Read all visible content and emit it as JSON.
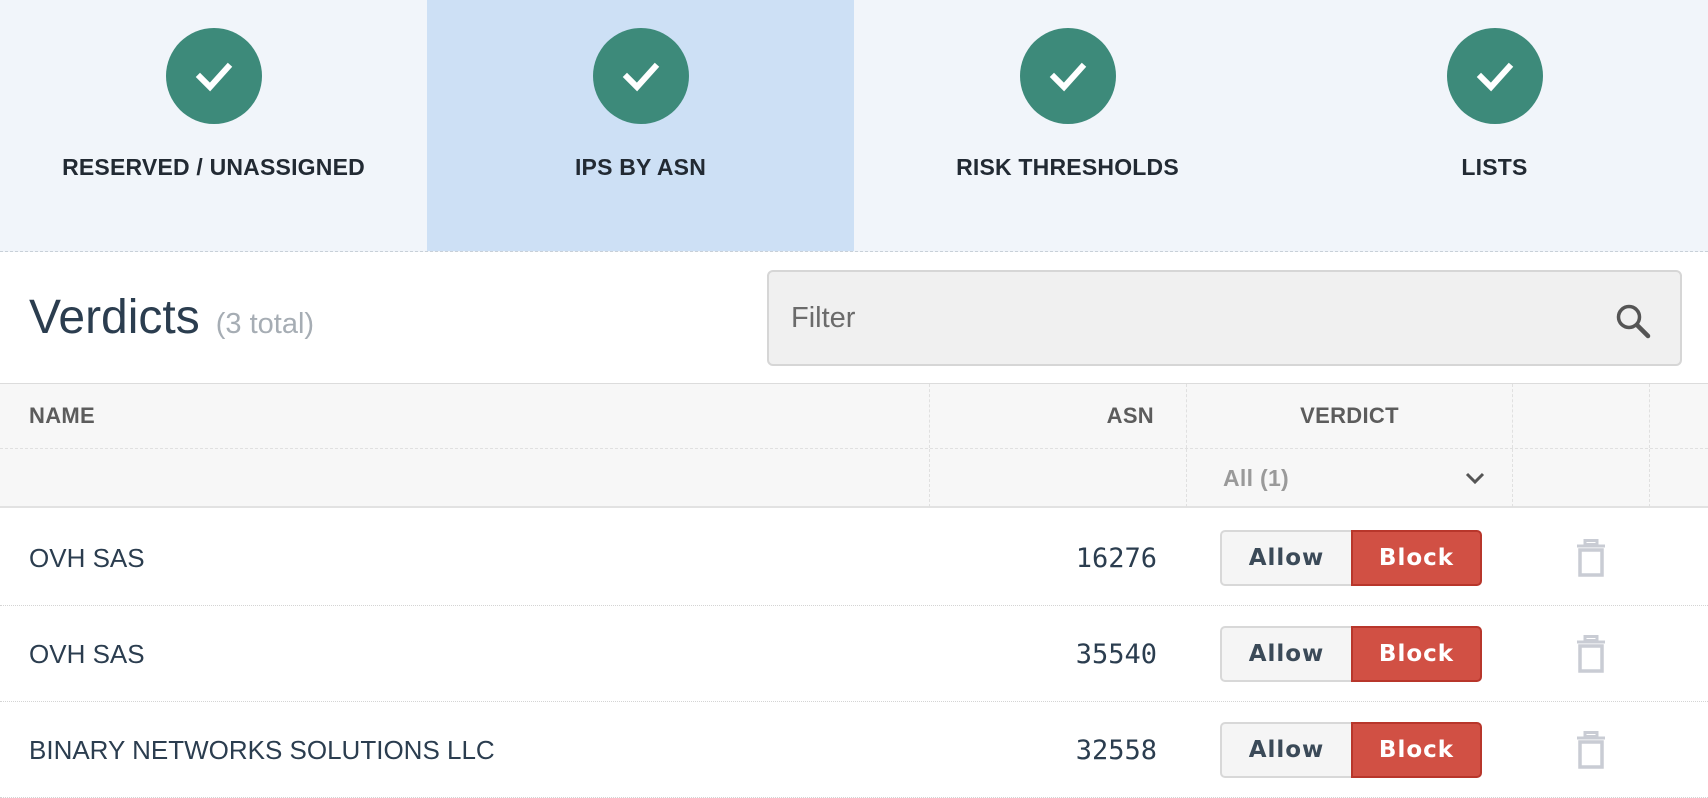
{
  "steps": [
    {
      "label": "RESERVED / UNASSIGNED",
      "status": "complete",
      "active": false
    },
    {
      "label": "IPS BY ASN",
      "status": "complete",
      "active": true
    },
    {
      "label": "RISK THRESHOLDS",
      "status": "complete",
      "active": false
    },
    {
      "label": "LISTS",
      "status": "complete",
      "active": false
    }
  ],
  "header": {
    "title": "Verdicts",
    "count": "(3 total)",
    "filter_placeholder": "Filter"
  },
  "table": {
    "columns": {
      "name": "NAME",
      "asn": "ASN",
      "verdict": "VERDICT"
    },
    "verdict_filter": "All (1)",
    "allow_label": "Allow",
    "block_label": "Block",
    "rows": [
      {
        "name": "OVH SAS",
        "asn": "16276",
        "verdict": "Block"
      },
      {
        "name": "OVH SAS",
        "asn": "35540",
        "verdict": "Block"
      },
      {
        "name": "BINARY NETWORKS SOLUTIONS LLC",
        "asn": "32558",
        "verdict": "Block"
      }
    ]
  },
  "colors": {
    "step_complete": "#3d8a7a",
    "step_active_bg": "#cde0f5",
    "block_active": "#d15044"
  },
  "icons": {
    "step": "check-icon",
    "filter": "search-icon",
    "row_action": "trash-icon",
    "select": "chevron-down-icon"
  }
}
